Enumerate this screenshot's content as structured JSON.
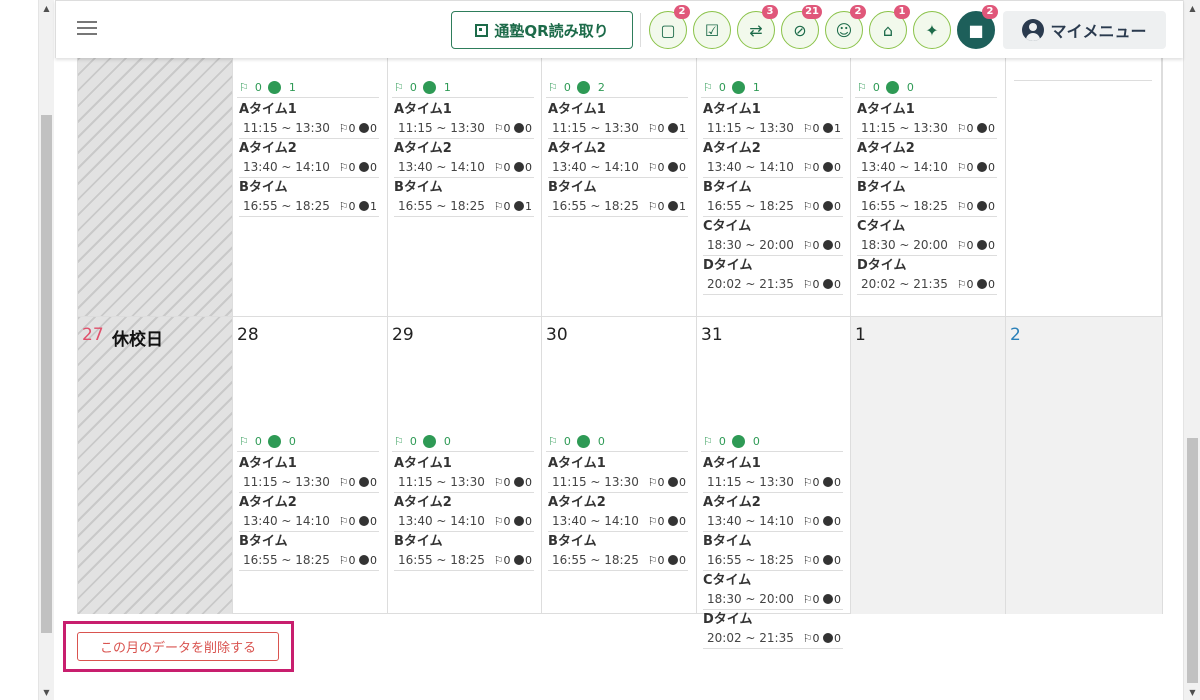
{
  "header": {
    "qr_label": "通塾QR読み取り",
    "my_menu_label": "マイメニュー",
    "icon_buttons": [
      {
        "icon": "chat-bubble-icon",
        "badge": "2"
      },
      {
        "icon": "checklist-icon",
        "badge": ""
      },
      {
        "icon": "exchange-arrows-icon",
        "badge": "3"
      },
      {
        "icon": "no-entry-icon",
        "badge": "21"
      },
      {
        "icon": "group-icon",
        "badge": "2"
      },
      {
        "icon": "bank-icon",
        "badge": "1"
      },
      {
        "icon": "gift-icon",
        "badge": ""
      },
      {
        "icon": "message-icon",
        "badge": "2"
      }
    ]
  },
  "calendar": {
    "week1": {
      "days": [
        {
          "closed": true
        },
        {
          "t": "0",
          "s": "1",
          "slots": [
            {
              "name": "Aタイム1",
              "time": "11:15 ~ 13:30",
              "t": "0",
              "s": "0"
            },
            {
              "name": "Aタイム2",
              "time": "13:40 ~ 14:10",
              "t": "0",
              "s": "0"
            },
            {
              "name": "Bタイム",
              "time": "16:55 ~ 18:25",
              "t": "0",
              "s": "1"
            }
          ]
        },
        {
          "t": "0",
          "s": "1",
          "slots": [
            {
              "name": "Aタイム1",
              "time": "11:15 ~ 13:30",
              "t": "0",
              "s": "0"
            },
            {
              "name": "Aタイム2",
              "time": "13:40 ~ 14:10",
              "t": "0",
              "s": "0"
            },
            {
              "name": "Bタイム",
              "time": "16:55 ~ 18:25",
              "t": "0",
              "s": "1"
            }
          ]
        },
        {
          "t": "0",
          "s": "2",
          "slots": [
            {
              "name": "Aタイム1",
              "time": "11:15 ~ 13:30",
              "t": "0",
              "s": "1"
            },
            {
              "name": "Aタイム2",
              "time": "13:40 ~ 14:10",
              "t": "0",
              "s": "0"
            },
            {
              "name": "Bタイム",
              "time": "16:55 ~ 18:25",
              "t": "0",
              "s": "1"
            }
          ]
        },
        {
          "t": "0",
          "s": "1",
          "slots": [
            {
              "name": "Aタイム1",
              "time": "11:15 ~ 13:30",
              "t": "0",
              "s": "1"
            },
            {
              "name": "Aタイム2",
              "time": "13:40 ~ 14:10",
              "t": "0",
              "s": "0"
            },
            {
              "name": "Bタイム",
              "time": "16:55 ~ 18:25",
              "t": "0",
              "s": "0"
            },
            {
              "name": "Cタイム",
              "time": "18:30 ~ 20:00",
              "t": "0",
              "s": "0"
            },
            {
              "name": "Dタイム",
              "time": "20:02 ~ 21:35",
              "t": "0",
              "s": "0"
            }
          ]
        },
        {
          "t": "0",
          "s": "0",
          "slots": [
            {
              "name": "Aタイム1",
              "time": "11:15 ~ 13:30",
              "t": "0",
              "s": "0"
            },
            {
              "name": "Aタイム2",
              "time": "13:40 ~ 14:10",
              "t": "0",
              "s": "0"
            },
            {
              "name": "Bタイム",
              "time": "16:55 ~ 18:25",
              "t": "0",
              "s": "0"
            },
            {
              "name": "Cタイム",
              "time": "18:30 ~ 20:00",
              "t": "0",
              "s": "0"
            },
            {
              "name": "Dタイム",
              "time": "20:02 ~ 21:35",
              "t": "0",
              "s": "0"
            }
          ]
        },
        {
          "empty": true
        }
      ]
    },
    "week2": {
      "holiday_label": "休校日",
      "days": [
        {
          "num": "27",
          "closed": true
        },
        {
          "num": "28",
          "t": "0",
          "s": "0",
          "slots": [
            {
              "name": "Aタイム1",
              "time": "11:15 ~ 13:30",
              "t": "0",
              "s": "0"
            },
            {
              "name": "Aタイム2",
              "time": "13:40 ~ 14:10",
              "t": "0",
              "s": "0"
            },
            {
              "name": "Bタイム",
              "time": "16:55 ~ 18:25",
              "t": "0",
              "s": "0"
            }
          ]
        },
        {
          "num": "29",
          "t": "0",
          "s": "0",
          "slots": [
            {
              "name": "Aタイム1",
              "time": "11:15 ~ 13:30",
              "t": "0",
              "s": "0"
            },
            {
              "name": "Aタイム2",
              "time": "13:40 ~ 14:10",
              "t": "0",
              "s": "0"
            },
            {
              "name": "Bタイム",
              "time": "16:55 ~ 18:25",
              "t": "0",
              "s": "0"
            }
          ]
        },
        {
          "num": "30",
          "t": "0",
          "s": "0",
          "slots": [
            {
              "name": "Aタイム1",
              "time": "11:15 ~ 13:30",
              "t": "0",
              "s": "0"
            },
            {
              "name": "Aタイム2",
              "time": "13:40 ~ 14:10",
              "t": "0",
              "s": "0"
            },
            {
              "name": "Bタイム",
              "time": "16:55 ~ 18:25",
              "t": "0",
              "s": "0"
            }
          ]
        },
        {
          "num": "31",
          "t": "0",
          "s": "0",
          "slots": [
            {
              "name": "Aタイム1",
              "time": "11:15 ~ 13:30",
              "t": "0",
              "s": "0"
            },
            {
              "name": "Aタイム2",
              "time": "13:40 ~ 14:10",
              "t": "0",
              "s": "0"
            },
            {
              "name": "Bタイム",
              "time": "16:55 ~ 18:25",
              "t": "0",
              "s": "0"
            },
            {
              "name": "Cタイム",
              "time": "18:30 ~ 20:00",
              "t": "0",
              "s": "0"
            },
            {
              "name": "Dタイム",
              "time": "20:02 ~ 21:35",
              "t": "0",
              "s": "0"
            }
          ]
        },
        {
          "num": "1",
          "gray": true
        },
        {
          "num": "2",
          "gray": true
        }
      ]
    }
  },
  "delete_button_label": "この月のデータを削除する",
  "colors": {
    "accent_green": "#2e9a55",
    "brand_dark": "#1d5f5a",
    "badge": "#e0577a",
    "danger": "#d9534f",
    "highlight": "#c81e6e"
  }
}
